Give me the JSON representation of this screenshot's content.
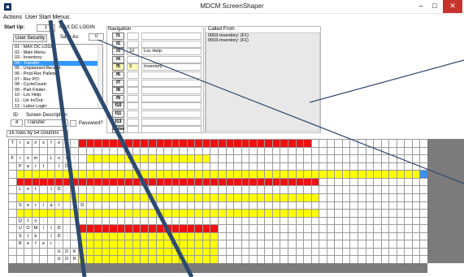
{
  "window": {
    "title": "MDCM ScreenShaper",
    "controls": {
      "minimize": "–",
      "maximize": "□",
      "close": "✕"
    },
    "close_color": "#c7332d"
  },
  "menu": [
    "Actions",
    "User Start Menus"
  ],
  "header": {
    "start_up_label": "Start Up:",
    "start_up_value": "1",
    "start_up_name": "MAX DC  LOGIN",
    "save_as_label": "Save As:",
    "save_as_value": "0",
    "user_security_button": "User Security"
  },
  "screen_list": {
    "items": [
      "01 - MAX DC  LOGIN",
      "02 - Main Menu:",
      "03 - Inventory:",
      "04 - Transfer",
      "05 - Unplanned Receipt",
      "06 - Prod Rec Pallets",
      "07 - Rec PO:",
      "08 - CycleCount:",
      "09 - Part Finder:",
      "10 - Loc Help:",
      "11 - Lbr In/Out:",
      "12 - Labor Login:"
    ],
    "selected_index": 3
  },
  "screen_info": {
    "id_label": "ID",
    "desc_label": "Screen Description",
    "id_value": "4",
    "desc_value": "Transfer:",
    "password_label": "Password?",
    "size_text": "16 rows by 54 columns"
  },
  "navigation": {
    "label": "Navigation",
    "rows": [
      {
        "key": "f1",
        "num": "",
        "target": ""
      },
      {
        "key": "f2",
        "num": "",
        "target": ""
      },
      {
        "key": "f3",
        "num": "10",
        "target": "Loc Help:"
      },
      {
        "key": "f4",
        "num": "",
        "target": ""
      },
      {
        "key": "f5",
        "num": "3",
        "target": "Inventory:"
      },
      {
        "key": "f6",
        "num": "",
        "target": ""
      },
      {
        "key": "f7",
        "num": "",
        "target": ""
      },
      {
        "key": "f8",
        "num": "",
        "target": ""
      },
      {
        "key": "f9",
        "num": "",
        "target": ""
      },
      {
        "key": "f10",
        "num": "",
        "target": ""
      },
      {
        "key": "f11",
        "num": "",
        "target": ""
      },
      {
        "key": "f13",
        "num": "",
        "target": ""
      },
      {
        "key": "Enter",
        "num": "",
        "target": ""
      }
    ],
    "highlight_key": "f5",
    "highlight_color": "#fff8b8"
  },
  "called_from": {
    "label": "Called From",
    "lines": [
      "0003-Inventory: (F1)",
      "0503-Inventory: (F1)"
    ]
  },
  "grid": {
    "rows": 16,
    "cols": 54,
    "colors": {
      "red": "#ee1111",
      "yellow": "#ffff00",
      "blue": "#3c8ee8"
    },
    "text": [
      {
        "row": 0,
        "col": 0,
        "chars": "Transfer:"
      },
      {
        "row": 2,
        "col": 0,
        "chars": "From Loc:"
      },
      {
        "row": 3,
        "col": 1,
        "chars": "Part ID:"
      },
      {
        "row": 6,
        "col": 1,
        "chars": "Lot ID:"
      },
      {
        "row": 8,
        "col": 1,
        "chars": "Serial ID"
      },
      {
        "row": 10,
        "col": 1,
        "chars": "Qty:"
      },
      {
        "row": 11,
        "col": 1,
        "chars": "UOM/ID:"
      },
      {
        "row": 12,
        "col": 1,
        "chars": "Stk ID:"
      },
      {
        "row": 13,
        "col": 1,
        "chars": "Refer:"
      },
      {
        "row": 14,
        "col": 6,
        "chars": "UDK"
      },
      {
        "row": 15,
        "col": 6,
        "chars": "UDR"
      }
    ],
    "fills": [
      {
        "row": 0,
        "from": 9,
        "to": 38,
        "color": "red"
      },
      {
        "row": 2,
        "from": 10,
        "to": 25,
        "color": "yellow"
      },
      {
        "row": 4,
        "from": 1,
        "to": 52,
        "color": "yellow"
      },
      {
        "row": 4,
        "from": 53,
        "to": 53,
        "color": "blue"
      },
      {
        "row": 5,
        "from": 1,
        "to": 39,
        "color": "red"
      },
      {
        "row": 7,
        "from": 1,
        "to": 39,
        "color": "yellow"
      },
      {
        "row": 9,
        "from": 1,
        "to": 39,
        "color": "yellow"
      },
      {
        "row": 11,
        "from": 9,
        "to": 26,
        "color": "red"
      },
      {
        "row": 12,
        "from": 9,
        "to": 26,
        "color": "yellow"
      },
      {
        "row": 13,
        "from": 9,
        "to": 26,
        "color": "yellow"
      },
      {
        "row": 14,
        "from": 9,
        "to": 26,
        "color": "yellow"
      },
      {
        "row": 15,
        "from": 9,
        "to": 26,
        "color": "yellow"
      }
    ]
  },
  "annotation_color": "#2d4a6e"
}
